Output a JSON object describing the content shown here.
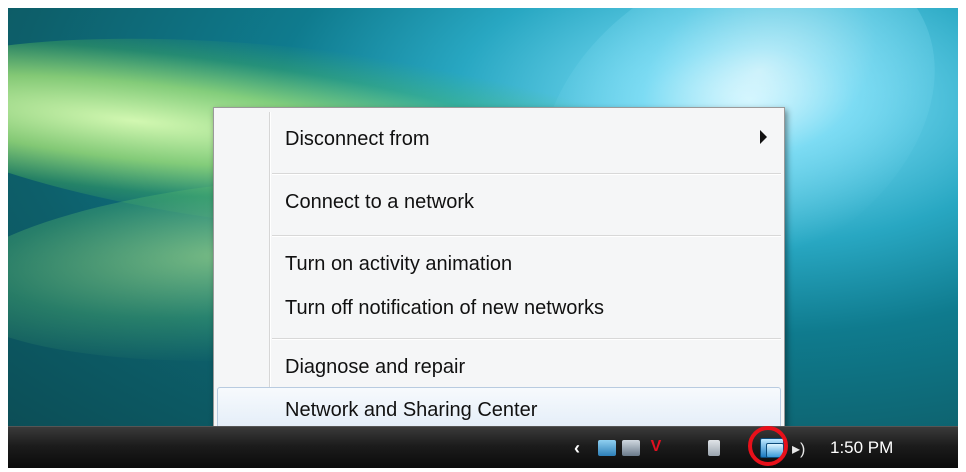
{
  "menu": {
    "items": [
      {
        "label": "Disconnect from",
        "submenu": true
      },
      {
        "label": "Connect to a network"
      },
      {
        "label": "Turn on activity animation"
      },
      {
        "label": "Turn off notification of new networks"
      },
      {
        "label": "Diagnose and repair"
      },
      {
        "label": "Network and Sharing Center",
        "highlighted": true
      }
    ]
  },
  "taskbar": {
    "clock": "1:50 PM",
    "tray_icons": [
      "show-hidden-icons-arrow",
      "network-status-icon",
      "volume-icon"
    ]
  },
  "colors": {
    "highlight_ring": "#e8101a",
    "menu_background": "#f5f6f7"
  }
}
